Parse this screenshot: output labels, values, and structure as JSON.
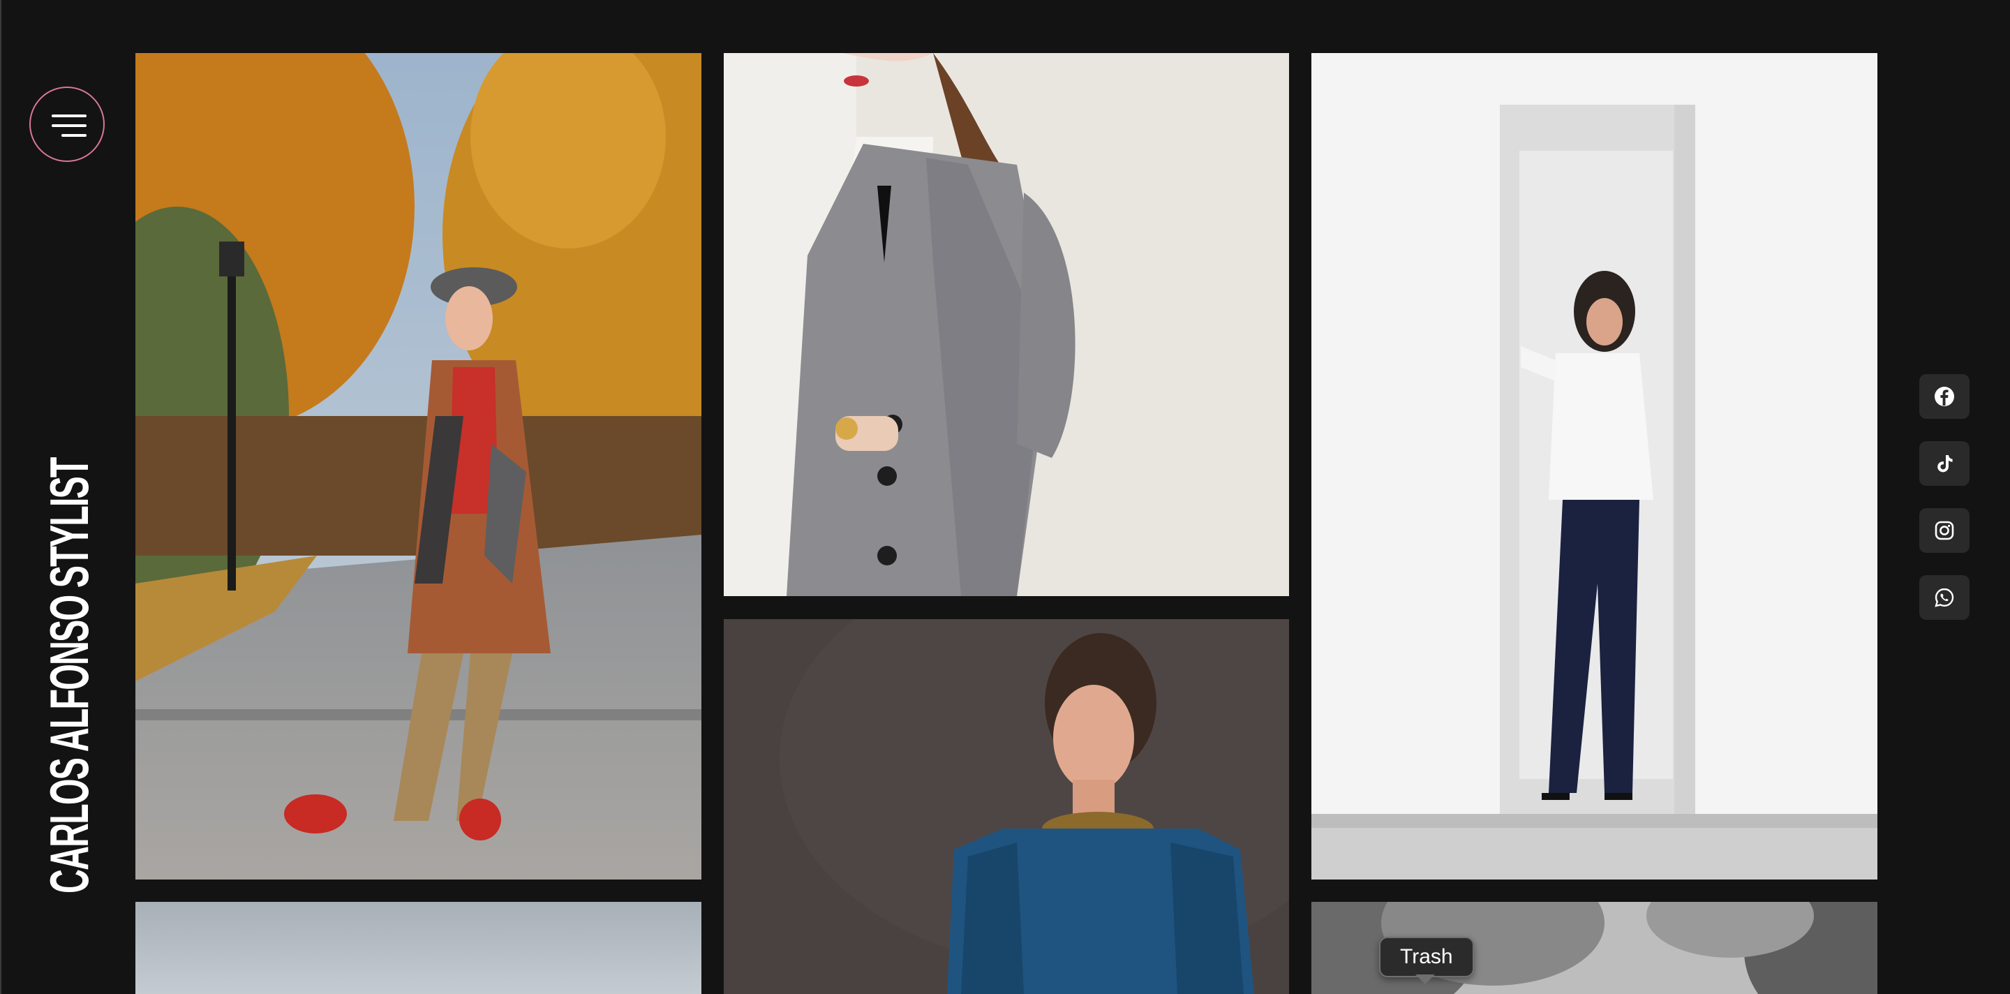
{
  "site": {
    "brand": "CARLOS ALFONSO STYLIST",
    "menu_icon": "hamburger-menu-icon",
    "accent_color": "#d9769a",
    "background_color": "#131313"
  },
  "gallery": {
    "items": [
      {
        "name": "woman in patterned coat in autumn park"
      },
      {
        "name": "grey plaid blazer close-up"
      },
      {
        "name": "woman in white shirt and navy trousers in white doorway"
      },
      {
        "name": "sky photo (partially visible)"
      },
      {
        "name": "model in teal velvet top with gold chain necklace"
      },
      {
        "name": "black and white trees photo (partially visible)"
      }
    ]
  },
  "social": [
    {
      "icon": "facebook-icon"
    },
    {
      "icon": "tiktok-icon"
    },
    {
      "icon": "instagram-icon"
    },
    {
      "icon": "whatsapp-icon"
    }
  ],
  "tooltip": {
    "text": "Trash"
  }
}
